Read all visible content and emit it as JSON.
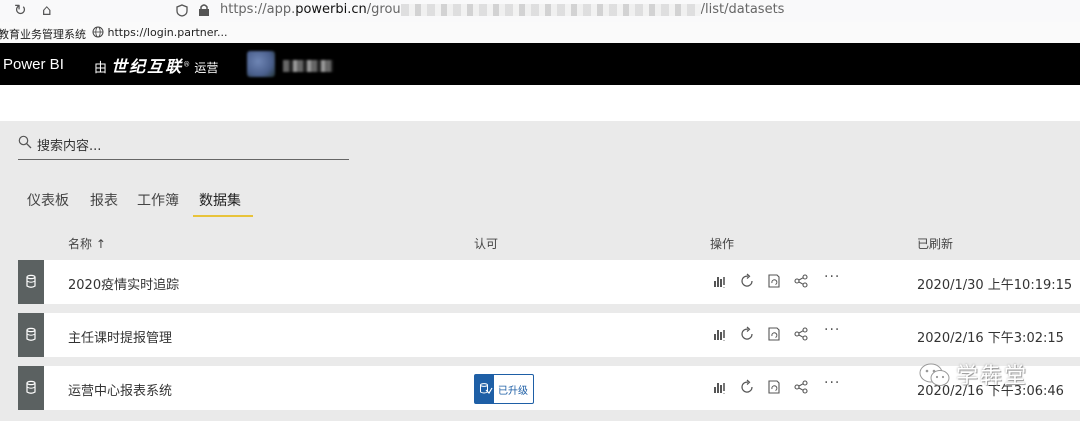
{
  "browser": {
    "url_prefix": "https://app.",
    "url_host": "powerbi.cn",
    "url_mid": "/grou",
    "url_suffix": "/list/datasets",
    "bookmarks": [
      {
        "label": "教育业务管理系统",
        "icon": "none"
      },
      {
        "label": "https://login.partner...",
        "icon": "globe-icon"
      }
    ]
  },
  "header": {
    "brand": "Power BI",
    "operated_prefix": "由",
    "operated_company": "世纪互联",
    "operated_suffix": "运营"
  },
  "search": {
    "placeholder": "搜索内容..."
  },
  "tabs": [
    {
      "label": "仪表板",
      "active": false
    },
    {
      "label": "报表",
      "active": false
    },
    {
      "label": "工作簿",
      "active": false
    },
    {
      "label": "数据集",
      "active": true
    }
  ],
  "columns": {
    "name": "名称",
    "name_sort": "↑",
    "endorsement": "认可",
    "actions": "操作",
    "refreshed": "已刷新"
  },
  "rows": [
    {
      "name": "2020疫情实时追踪",
      "endorsement": "",
      "refreshed": "2020/1/30 上午10:19:15"
    },
    {
      "name": "主任课时提报管理",
      "endorsement": "",
      "refreshed": "2020/2/16 下午3:02:15"
    },
    {
      "name": "运营中心报表系统",
      "endorsement": "已升级",
      "refreshed": "2020/2/16 下午3:06:46"
    }
  ],
  "action_icons": [
    "analyze-in-excel-icon",
    "refresh-icon",
    "schedule-refresh-icon",
    "lineage-icon",
    "more-options-icon"
  ],
  "more_label": "···",
  "watermark": {
    "label": "学犇堂"
  },
  "colors": {
    "accent_tab": "#e8c33a",
    "badge_blue": "#1e5fa6",
    "row_icon_bg": "#5b6161",
    "topbar": "#000000"
  }
}
